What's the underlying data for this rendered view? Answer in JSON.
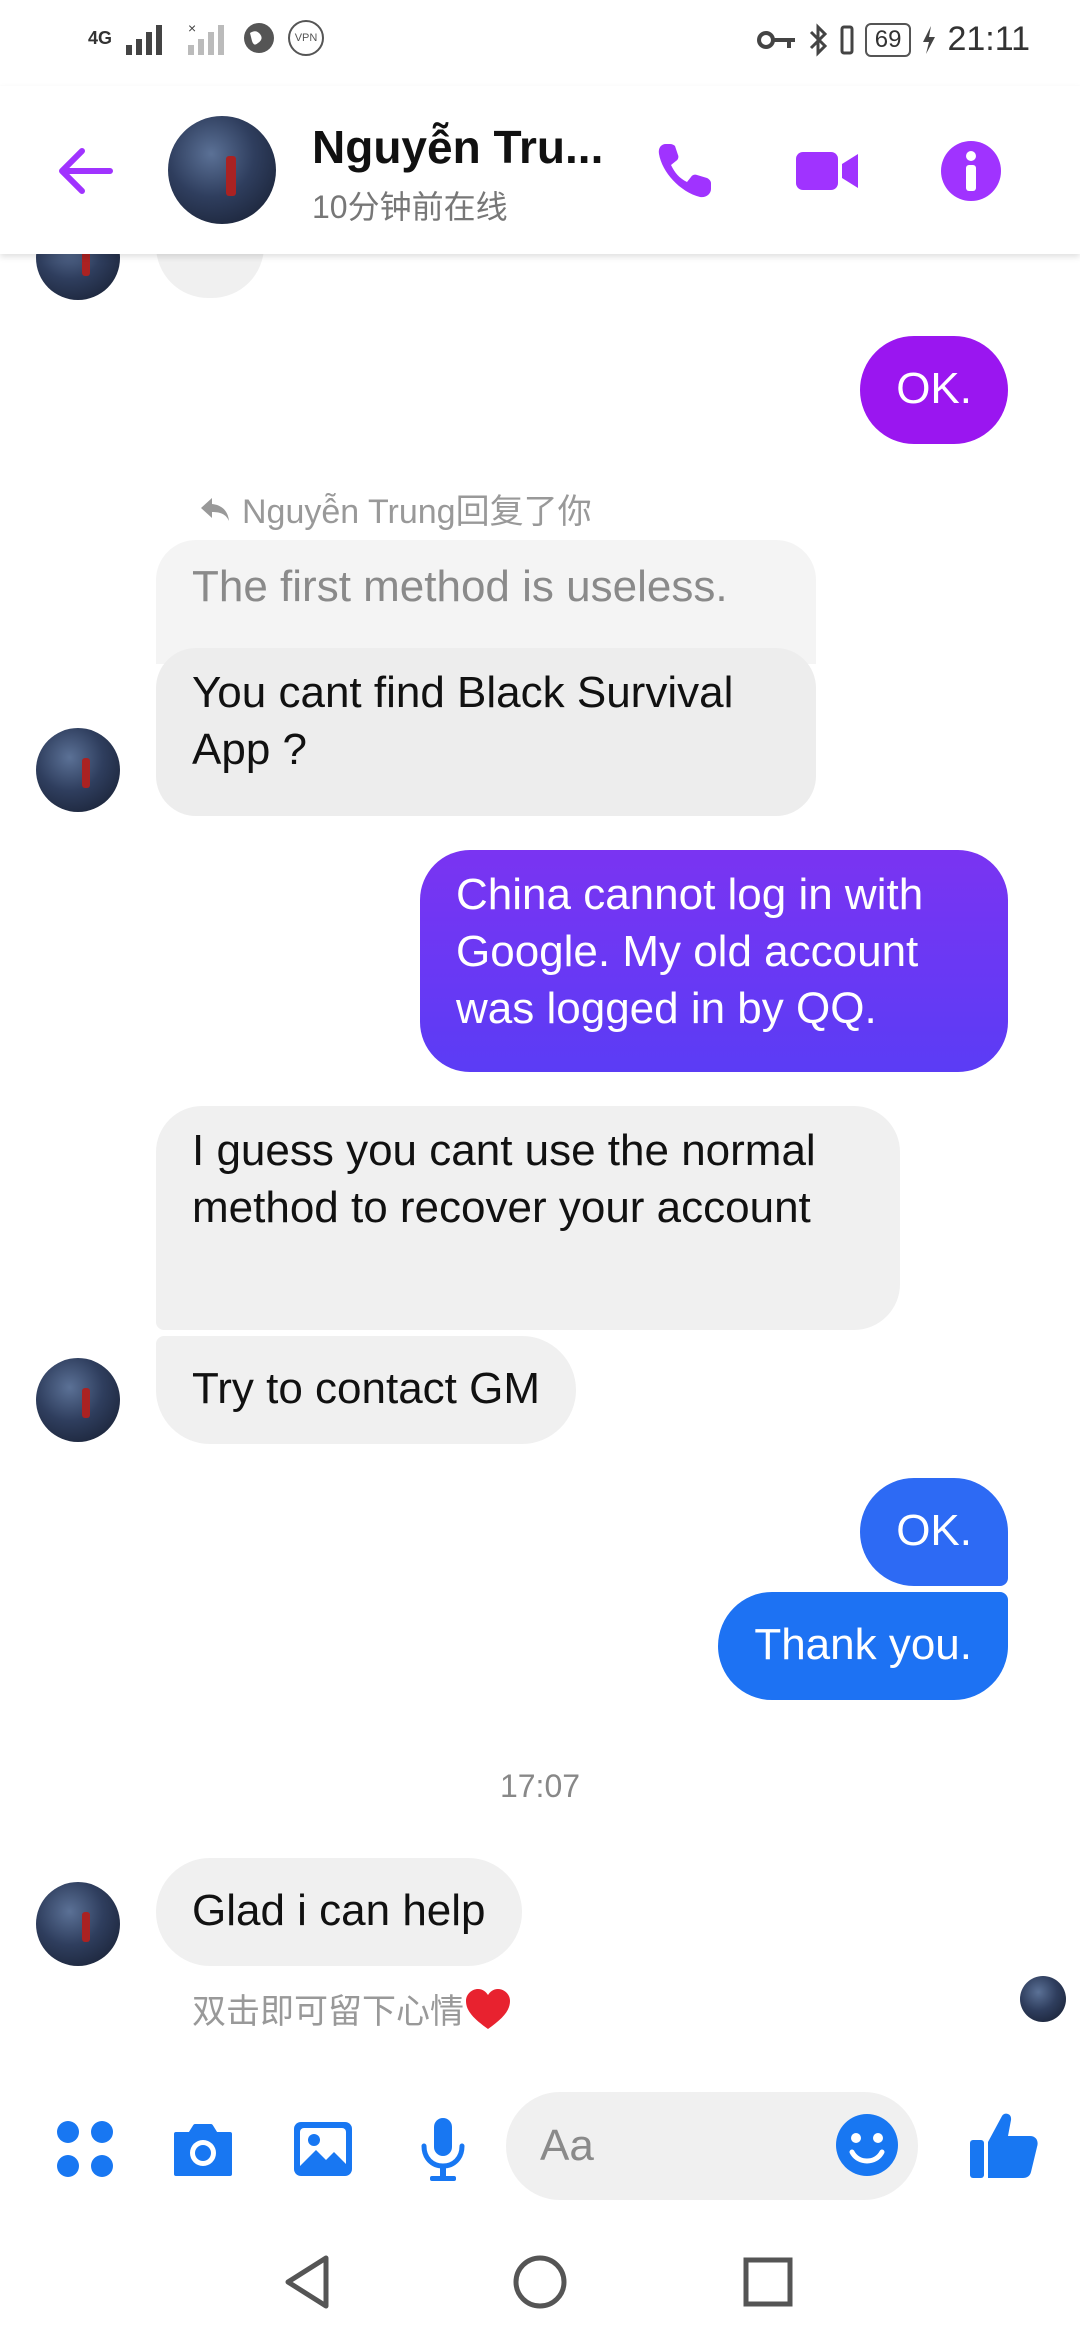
{
  "status_bar": {
    "network": "4G",
    "vpn": "VPN",
    "battery": "69",
    "time": "21:11"
  },
  "header": {
    "contact_name": "Nguyễn Tru...",
    "contact_status": "10分钟前在线"
  },
  "messages": {
    "partial_top": ".",
    "ok_1": "OK.",
    "reply_label": "Nguyễn Trung回复了你",
    "quoted": "The first method is useless.",
    "m1": "You cant find Black Survival App ?",
    "m2": "China cannot log in with Google.  My old account was logged in by QQ.",
    "m3": "I guess you cant use the normal method to recover your account",
    "m4": "Try to contact GM",
    "ok_2": "OK.",
    "thanks": "Thank you.",
    "time": "17:07",
    "m5": "Glad i can help",
    "hint": "双击即可留下心情"
  },
  "composer": {
    "placeholder": "Aa"
  },
  "colors": {
    "header_accent": "#a033ff",
    "composer_accent": "#1877f2",
    "out_purple": "#9a16f0",
    "out_violet": "#6a3bf5",
    "out_blue": "#2b6ef5",
    "in_gray": "#f0f0f0"
  }
}
